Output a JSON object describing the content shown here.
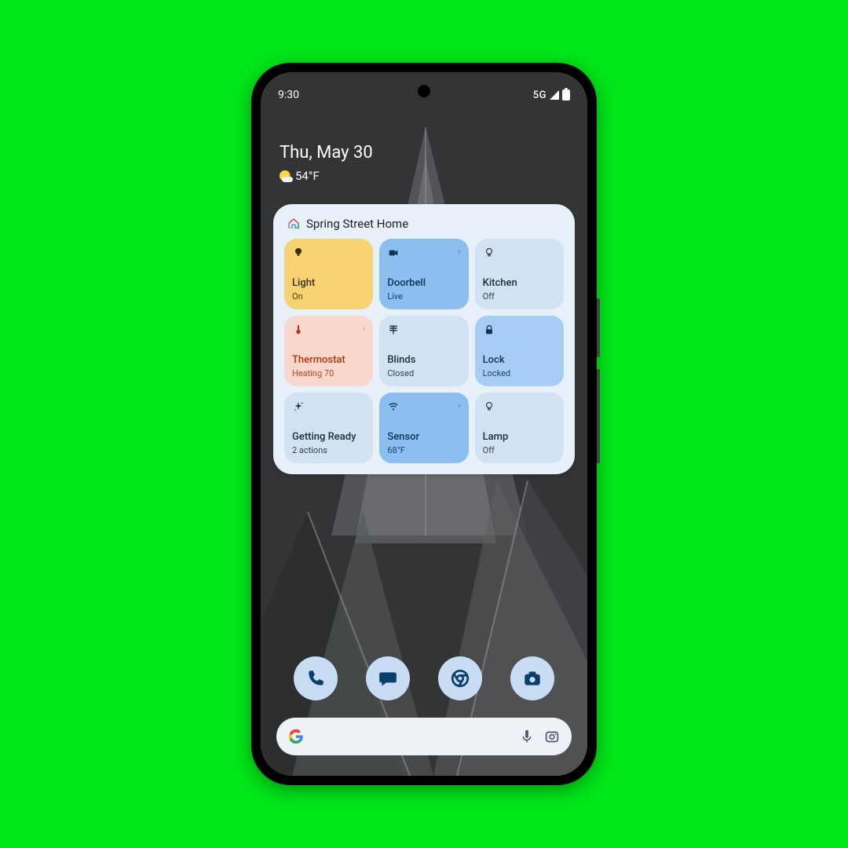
{
  "status": {
    "time": "9:30",
    "network": "5G"
  },
  "header": {
    "date": "Thu, May 30",
    "temp": "54°F"
  },
  "widget": {
    "title": "Spring Street Home",
    "tiles": [
      {
        "name": "Light",
        "sub": "On",
        "icon": "bulb",
        "theme": "t-yellow",
        "chevron": false
      },
      {
        "name": "Doorbell",
        "sub": "Live",
        "icon": "videocam",
        "theme": "t-blue",
        "chevron": true
      },
      {
        "name": "Kitchen",
        "sub": "Off",
        "icon": "bulb-outline",
        "theme": "t-pale",
        "chevron": false
      },
      {
        "name": "Thermostat",
        "sub": "Heating 70",
        "icon": "thermo",
        "theme": "t-peach",
        "chevron": true
      },
      {
        "name": "Blinds",
        "sub": "Closed",
        "icon": "blinds",
        "theme": "t-pale",
        "chevron": false
      },
      {
        "name": "Lock",
        "sub": "Locked",
        "icon": "lock",
        "theme": "t-bluea",
        "chevron": false
      },
      {
        "name": "Getting Ready",
        "sub": "2 actions",
        "icon": "sparkle",
        "theme": "t-pale",
        "chevron": false
      },
      {
        "name": "Sensor",
        "sub": "68°F",
        "icon": "wifi",
        "theme": "t-blue",
        "chevron": true
      },
      {
        "name": "Lamp",
        "sub": "Off",
        "icon": "bulb-outline",
        "theme": "t-pale",
        "chevron": false
      }
    ]
  },
  "dock": [
    "phone",
    "messages",
    "chrome",
    "camera"
  ]
}
